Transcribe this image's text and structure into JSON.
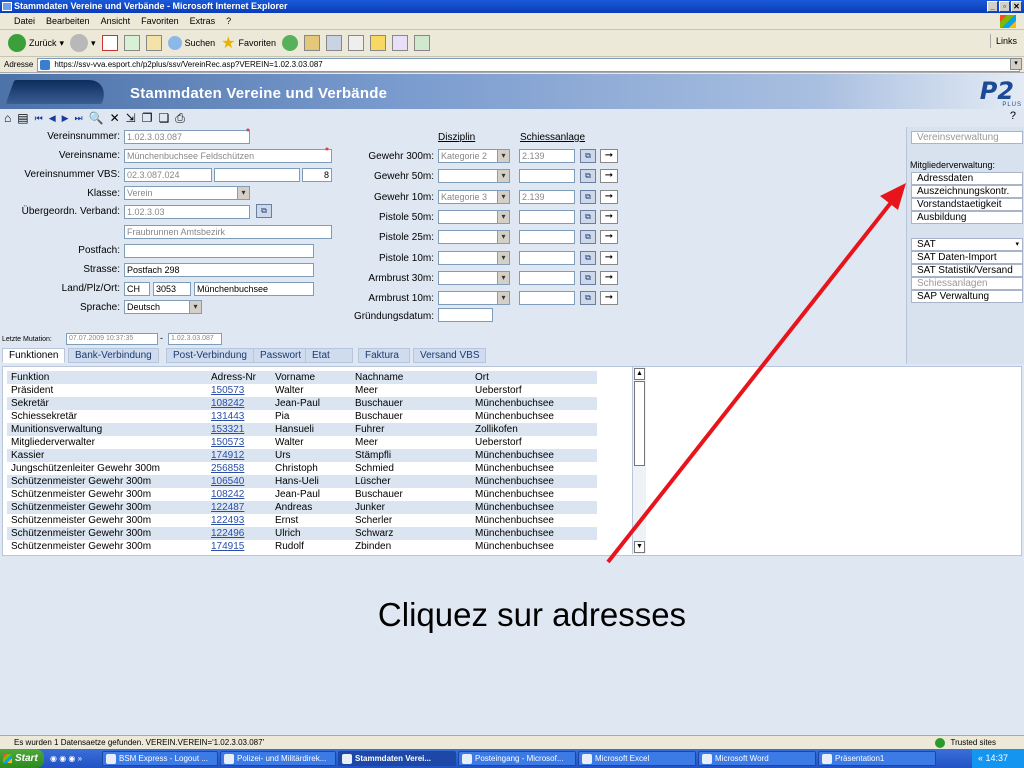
{
  "window": {
    "title": "Stammdaten Vereine und Verbände - Microsoft Internet Explorer"
  },
  "menu": [
    "Datei",
    "Bearbeiten",
    "Ansicht",
    "Favoriten",
    "Extras",
    "?"
  ],
  "toolbar": {
    "back": "Zurück",
    "search": "Suchen",
    "favorites": "Favoriten",
    "links": "Links"
  },
  "address": {
    "label": "Adresse",
    "url": "https://ssv-vva.esport.ch/p2plus/ssv/VereinRec.asp?VEREIN=1.02.3.03.087"
  },
  "banner": {
    "title": "Stammdaten Vereine und Verbände",
    "logo": "P2",
    "logo_sub": "PLUS"
  },
  "help": "?",
  "form": {
    "vereinsnummer_label": "Vereinsnummer:",
    "vereinsnummer": "1.02.3.03.087",
    "vereinsname_label": "Vereinsname:",
    "vereinsname": "Münchenbuchsee Feldschützen",
    "vbs_label": "Vereinsnummer VBS:",
    "vbs": "02.3.087.024",
    "vbs_extra": "8",
    "klasse_label": "Klasse:",
    "klasse": "Verein",
    "verband_label": "Übergeordn. Verband:",
    "verband": "1.02.3.03",
    "verband_name": "Fraubrunnen Amtsbezirk",
    "postfach_label": "Postfach:",
    "postfach": "",
    "strasse_label": "Strasse:",
    "strasse": "Postfach 298",
    "ort_label": "Land/Plz/Ort:",
    "land": "CH",
    "plz": "3053",
    "ort": "Münchenbuchsee",
    "sprache_label": "Sprache:",
    "sprache": "Deutsch",
    "mutation_label": "Letzte Mutation:",
    "mutation_date": "07.07.2009 10:37:35",
    "mutation_sep": "-",
    "mutation_user": "1.02.3.03.087"
  },
  "discipline": {
    "col1": "Disziplin",
    "col2": "Schiessanlage",
    "rows": [
      {
        "label": "Gewehr 300m:",
        "kat": "Kategorie 2",
        "anl": "2.139"
      },
      {
        "label": "Gewehr 50m:",
        "kat": "",
        "anl": ""
      },
      {
        "label": "Gewehr 10m:",
        "kat": "Kategorie 3",
        "anl": "2.139"
      },
      {
        "label": "Pistole 50m:",
        "kat": "",
        "anl": ""
      },
      {
        "label": "Pistole 25m:",
        "kat": "",
        "anl": ""
      },
      {
        "label": "Pistole 10m:",
        "kat": "",
        "anl": ""
      },
      {
        "label": "Armbrust 30m:",
        "kat": "",
        "anl": ""
      },
      {
        "label": "Armbrust 10m:",
        "kat": "",
        "anl": ""
      }
    ],
    "gruendung_label": "Gründungsdatum:",
    "gruendung": ""
  },
  "rightpanel": {
    "vereinsverwaltung": "Vereinsverwaltung",
    "mitglied_label": "Mitgliederverwaltung:",
    "items": [
      "Adressdaten",
      "Auszeichnungskontr.",
      "Vorstandstaetigkeit",
      "Ausbildung"
    ],
    "sat": "SAT",
    "sat_items": [
      "SAT Daten-Import",
      "SAT Statistik/Versand",
      "Schiessanlagen",
      "SAP Verwaltung"
    ]
  },
  "tabs": [
    "Funktionen",
    "Bank-Verbindung",
    "Post-Verbindung",
    "Passwort",
    "Etat",
    "Faktura",
    "Versand VBS"
  ],
  "table": {
    "headers": [
      "Funktion",
      "Adress-Nr",
      "Vorname",
      "Nachname",
      "Ort"
    ],
    "rows": [
      [
        "Präsident",
        "150573",
        "Walter",
        "Meer",
        "Ueberstorf"
      ],
      [
        "Sekretär",
        "108242",
        "Jean-Paul",
        "Buschauer",
        "Münchenbuchsee"
      ],
      [
        "Schiessekretär",
        "131443",
        "Pia",
        "Buschauer",
        "Münchenbuchsee"
      ],
      [
        "Munitionsverwaltung",
        "153321",
        "Hansueli",
        "Fuhrer",
        "Zollikofen"
      ],
      [
        "Mitgliederverwalter",
        "150573",
        "Walter",
        "Meer",
        "Ueberstorf"
      ],
      [
        "Kassier",
        "174912",
        "Urs",
        "Stämpfli",
        "Münchenbuchsee"
      ],
      [
        "Jungschützenleiter Gewehr 300m",
        "256858",
        "Christoph",
        "Schmied",
        "Münchenbuchsee"
      ],
      [
        "Schützenmeister Gewehr 300m",
        "106540",
        "Hans-Ueli",
        "Lüscher",
        "Münchenbuchsee"
      ],
      [
        "Schützenmeister Gewehr 300m",
        "108242",
        "Jean-Paul",
        "Buschauer",
        "Münchenbuchsee"
      ],
      [
        "Schützenmeister Gewehr 300m",
        "122487",
        "Andreas",
        "Junker",
        "Münchenbuchsee"
      ],
      [
        "Schützenmeister Gewehr 300m",
        "122493",
        "Ernst",
        "Scherler",
        "Münchenbuchsee"
      ],
      [
        "Schützenmeister Gewehr 300m",
        "122496",
        "Ulrich",
        "Schwarz",
        "Münchenbuchsee"
      ],
      [
        "Schützenmeister Gewehr 300m",
        "174915",
        "Rudolf",
        "Zbinden",
        "Münchenbuchsee"
      ]
    ]
  },
  "caption": "Cliquez sur adresses",
  "arrow_color": "#e8141c",
  "status": {
    "text": "Es wurden 1 Datensaetze gefunden. VEREIN.VEREIN='1.02.3.03.087'",
    "zone": "Trusted sites"
  },
  "taskbar": {
    "start": "Start",
    "tasks": [
      "BSM Express - Logout ...",
      "Polizei- und Militärdirek...",
      "Stammdaten Verei...",
      "Posteingang - Microsof...",
      "Microsoft Excel",
      "Microsoft Word",
      "Präsentation1"
    ],
    "clock": "14:37"
  }
}
